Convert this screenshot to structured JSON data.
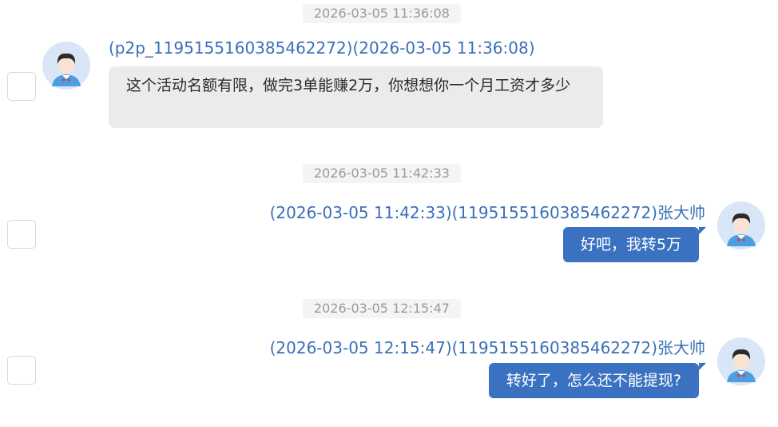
{
  "messages": [
    {
      "timestamp": "2026-03-05 11:36:08",
      "sender": "(p2p_1195155160385462272)(2026-03-05 11:36:08)",
      "text": "这个活动名额有限，做完3单能赚2万，你想想你一个月工资才多少",
      "direction": "incoming"
    },
    {
      "timestamp": "2026-03-05 11:42:33",
      "sender": "(2026-03-05 11:42:33)(1195155160385462272)张大帅",
      "text": "好吧，我转5万",
      "direction": "outgoing"
    },
    {
      "timestamp": "2026-03-05 12:15:47",
      "sender": "(2026-03-05 12:15:47)(1195155160385462272)张大帅",
      "text": "转好了，怎么还不能提现?",
      "direction": "outgoing"
    }
  ],
  "colors": {
    "sender_text": "#3a6fb8",
    "outgoing_bubble": "#3a72c1",
    "incoming_bubble": "#ebebeb",
    "timestamp_pill": "#f4f4f4"
  },
  "icons": {
    "avatar": "user-avatar-icon",
    "checkbox": "select-checkbox"
  }
}
